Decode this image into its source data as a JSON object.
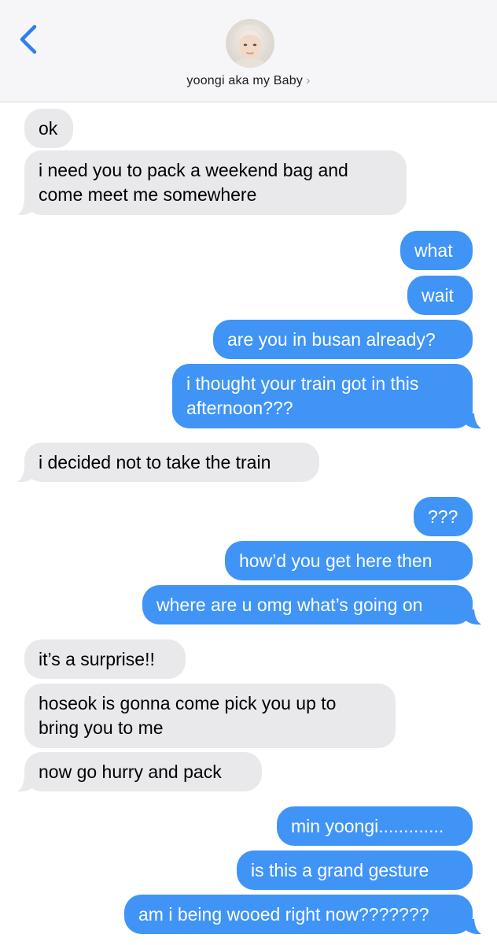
{
  "header": {
    "contact_name": "yoongi aka my Baby",
    "chevron": "›",
    "back_icon": "chevron-left-icon"
  },
  "colors": {
    "incoming_bubble": "#e9e9eb",
    "outgoing_bubble": "#3f94f6",
    "accent": "#2f7ff0"
  },
  "messages": [
    {
      "side": "in",
      "lines": [
        "ok"
      ]
    },
    {
      "side": "in",
      "lines": [
        "i need you to pack a weekend bag and",
        "come meet me somewhere"
      ]
    },
    {
      "side": "out",
      "lines": [
        "what"
      ]
    },
    {
      "side": "out",
      "lines": [
        "wait"
      ]
    },
    {
      "side": "out",
      "lines": [
        "are you in busan already?"
      ]
    },
    {
      "side": "out",
      "lines": [
        "i thought your train got in this",
        "afternoon???"
      ]
    },
    {
      "side": "in",
      "lines": [
        "i decided not to take the train"
      ]
    },
    {
      "side": "out",
      "lines": [
        "???"
      ]
    },
    {
      "side": "out",
      "lines": [
        "how’d you get here then"
      ]
    },
    {
      "side": "out",
      "lines": [
        "where are u omg what’s going on"
      ]
    },
    {
      "side": "in",
      "lines": [
        "it’s a surprise!!"
      ]
    },
    {
      "side": "in",
      "lines": [
        "hoseok is gonna come pick you up to",
        "bring you to me"
      ]
    },
    {
      "side": "in",
      "lines": [
        "now go hurry and pack"
      ]
    },
    {
      "side": "out",
      "lines": [
        "min yoongi............."
      ]
    },
    {
      "side": "out",
      "lines": [
        "is this a grand gesture"
      ]
    },
    {
      "side": "out",
      "lines": [
        "am i being wooed right now???????"
      ]
    }
  ]
}
